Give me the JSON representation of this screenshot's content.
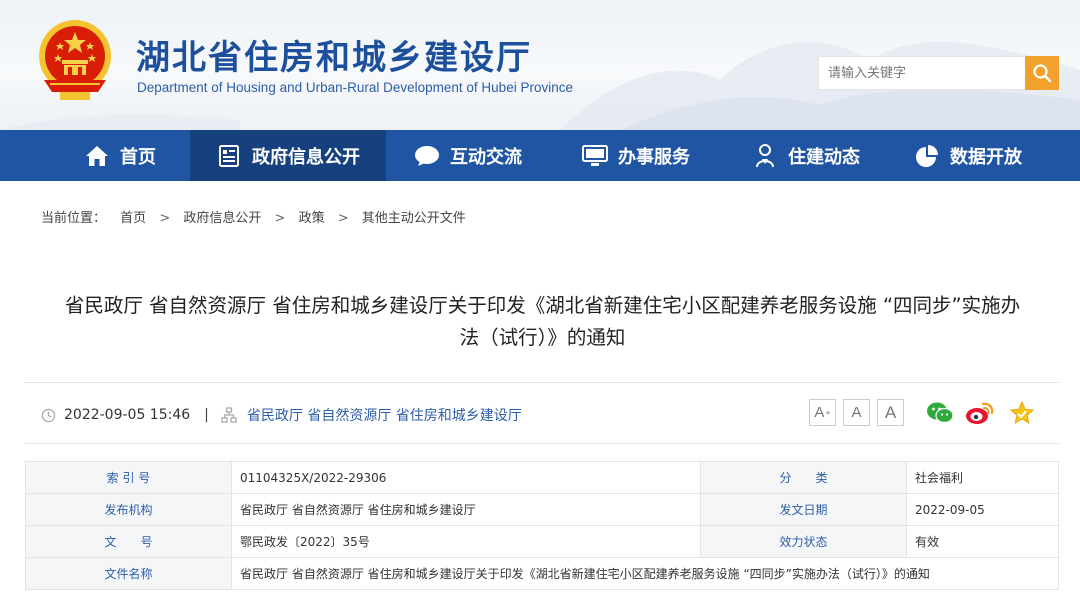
{
  "header": {
    "site_title": "湖北省住房和城乡建设厅",
    "site_subtitle": "Department of Housing and Urban-Rural Development of Hubei Province",
    "search_placeholder": "请输入关键字"
  },
  "nav": {
    "items": [
      {
        "label": "首页",
        "icon": "home-icon"
      },
      {
        "label": "政府信息公开",
        "icon": "document-list-icon"
      },
      {
        "label": "互动交流",
        "icon": "chat-bubble-icon"
      },
      {
        "label": "办事服务",
        "icon": "monitor-icon"
      },
      {
        "label": "住建动态",
        "icon": "person-badge-icon"
      },
      {
        "label": "数据开放",
        "icon": "pie-chart-icon"
      }
    ],
    "active_index": 1
  },
  "breadcrumb": {
    "prefix": "当前位置：",
    "items": [
      "首页",
      "政府信息公开",
      "政策",
      "其他主动公开文件"
    ],
    "separator": ">"
  },
  "document": {
    "title_line1": "省民政厅 省自然资源厅 省住房和城乡建设厅关于印发《湖北省新建住宅小区配建养老服务设施 “四同步”实施办",
    "title_line2": "法（试行）》的通知",
    "datetime": "2022-09-05 15:46",
    "divider": "|",
    "source": "省民政厅 省自然资源厅 省住房和城乡建设厅"
  },
  "toolbar": {
    "font_increase": "A",
    "font_increase_mark": "+",
    "font_reset": "A",
    "font_normal": "A"
  },
  "info_table": {
    "rows": [
      {
        "label1": "索 引 号",
        "value1": "01104325X/2022-29306",
        "label2": "分　　类",
        "value2": "社会福利"
      },
      {
        "label1": "发布机构",
        "value1": "省民政厅 省自然资源厅 省住房和城乡建设厅",
        "label2": "发文日期",
        "value2": "2022-09-05"
      },
      {
        "label1": "文　　号",
        "value1": "鄂民政发〔2022〕35号",
        "label2": "效力状态",
        "value2": "有效"
      }
    ],
    "name_label": "文件名称",
    "name_value": "省民政厅 省自然资源厅 省住房和城乡建设厅关于印发《湖北省新建住宅小区配建养老服务设施 “四同步”实施办法（试行）》的通知"
  },
  "colors": {
    "brand_blue": "#2055a4",
    "nav_active": "#17407f",
    "title_blue": "#1c4f9c",
    "search_orange": "#f2a12c",
    "link_blue": "#2d5ea8"
  }
}
